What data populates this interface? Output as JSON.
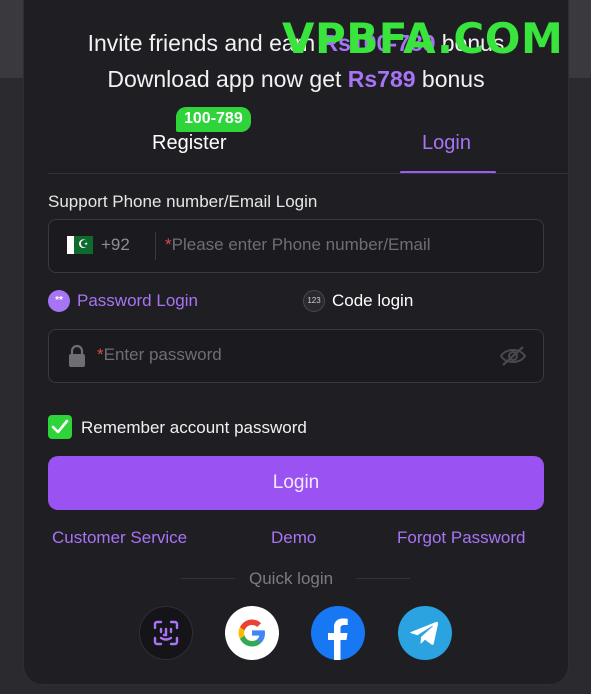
{
  "promo": {
    "line1_prefix": "Invite friends and earn ",
    "line1_amount": "Rs100-789",
    "line1_suffix": " bonus",
    "line2_prefix": "Download app now get ",
    "line2_amount": "Rs789",
    "line2_suffix": " bonus"
  },
  "watermark": "VPBFA.COM",
  "tabs": {
    "register_label": "Register",
    "register_badge": "100-789",
    "login_label": "Login",
    "active": "Login"
  },
  "form": {
    "section_label": "Support Phone number/Email Login",
    "phone": {
      "country_code": "+92",
      "required_mark": "*",
      "placeholder": "Please enter Phone number/Email"
    },
    "methods": {
      "password_label": "Password Login",
      "password_icon_text": "**",
      "code_label": "Code login",
      "code_icon_text": "123",
      "active": "Password Login"
    },
    "password": {
      "required_mark": "*",
      "placeholder": "Enter password"
    },
    "remember": {
      "label": "Remember account password",
      "checked": true
    },
    "submit_label": "Login"
  },
  "links": {
    "customer_service": "Customer Service",
    "demo": "Demo",
    "forgot_password": "Forgot Password"
  },
  "quick_login": {
    "label": "Quick login",
    "providers": [
      "face-id",
      "google",
      "facebook",
      "telegram"
    ]
  },
  "colors": {
    "accent": "#a774f5",
    "button": "#9a52f2",
    "badge_green": "#2fd43b",
    "watermark_green": "#39e43c",
    "panel_bg": "#1f1e23",
    "required_red": "#e2474f",
    "facebook_blue": "#1877f2",
    "telegram_blue": "#2aa3e0"
  }
}
